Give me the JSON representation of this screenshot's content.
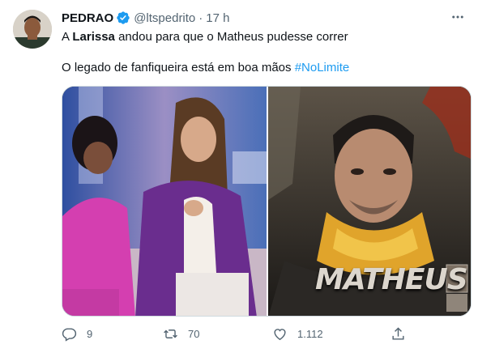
{
  "tweet": {
    "author_name": "PEDRAO",
    "author_handle": "@ltspedrito",
    "separator": "·",
    "timestamp": "17 h",
    "text_line1_prefix": "A ",
    "text_line1_bold": "Larissa",
    "text_line1_rest": " andou para que o Matheus pudesse correr",
    "text_line2": "O legado de  fanfiqueira está em boa mãos ",
    "hashtag": "#NoLimite",
    "image_right_caption": "MATHEUS"
  },
  "actions": {
    "replies": "9",
    "retweets": "70",
    "likes": "1.112"
  },
  "colors": {
    "accent": "#1d9bf0",
    "text": "#0f1419",
    "muted": "#536471",
    "border": "#cfd9de"
  },
  "icons": {
    "verified": "verified-badge-icon",
    "more": "more-dots-icon",
    "reply": "reply-icon",
    "retweet": "retweet-icon",
    "like": "heart-icon",
    "share": "share-icon"
  }
}
